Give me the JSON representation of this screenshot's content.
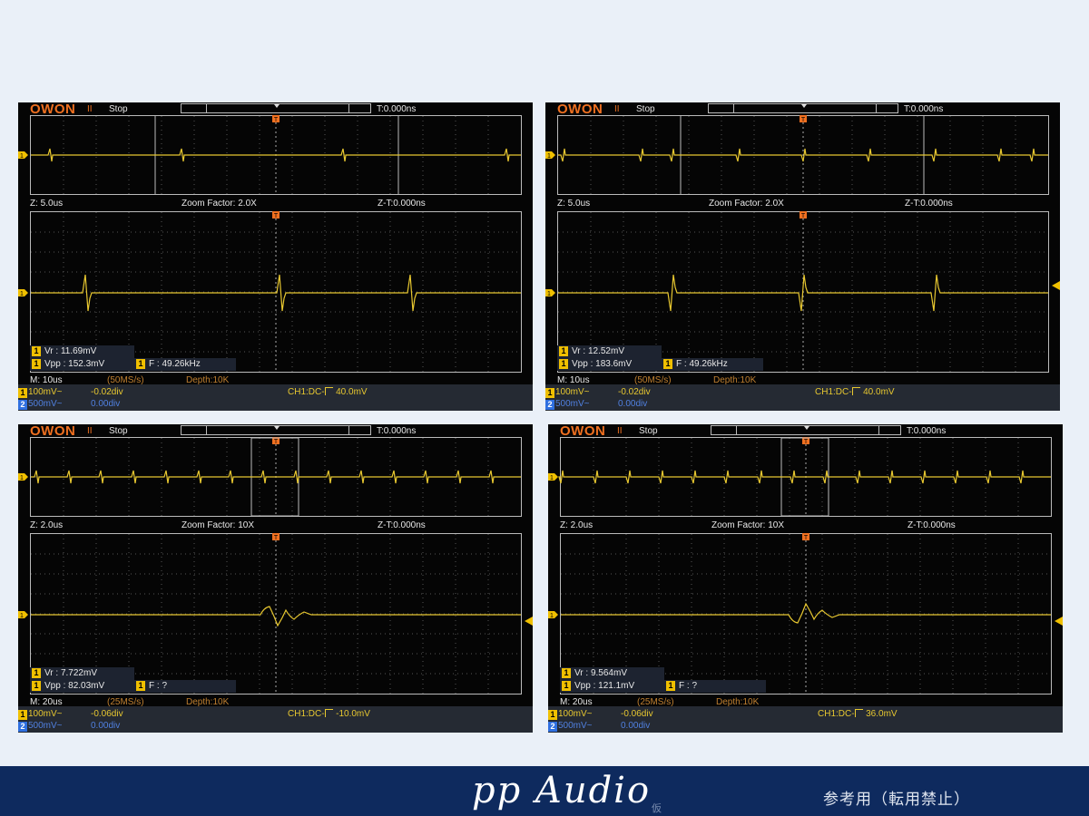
{
  "scopes": [
    {
      "logo": "OWON",
      "run_icon": "II",
      "status": "Stop",
      "trigger_time": "T:0.000ns",
      "zoom_time": "Z: 5.0us",
      "zoom_factor": "Zoom Factor: 2.0X",
      "zoom_t": "Z-T:0.000ns",
      "vr": "Vr : 11.69mV",
      "vpp": "Vpp : 152.3mV",
      "freq": "F : 49.26kHz",
      "main_time": "M: 10us",
      "sample_rate": "(50MS/s)",
      "depth": "Depth:10K",
      "ch1_scale": "100mV~",
      "ch1_offset": "-0.02div",
      "ch2_scale": "500mV~",
      "ch2_offset": "0.00div",
      "trigger": "CH1:DC-",
      "trigger_level": "40.0mV"
    },
    {
      "logo": "OWON",
      "run_icon": "II",
      "status": "Stop",
      "trigger_time": "T:0.000ns",
      "zoom_time": "Z: 5.0us",
      "zoom_factor": "Zoom Factor: 2.0X",
      "zoom_t": "Z-T:0.000ns",
      "vr": "Vr : 12.52mV",
      "vpp": "Vpp : 183.6mV",
      "freq": "F : 49.26kHz",
      "main_time": "M: 10us",
      "sample_rate": "(50MS/s)",
      "depth": "Depth:10K",
      "ch1_scale": "100mV~",
      "ch1_offset": "-0.02div",
      "ch2_scale": "500mV~",
      "ch2_offset": "0.00div",
      "trigger": "CH1:DC-",
      "trigger_level": "40.0mV"
    },
    {
      "logo": "OWON",
      "run_icon": "II",
      "status": "Stop",
      "trigger_time": "T:0.000ns",
      "zoom_time": "Z: 2.0us",
      "zoom_factor": "Zoom Factor: 10X",
      "zoom_t": "Z-T:0.000ns",
      "vr": "Vr : 7.722mV",
      "vpp": "Vpp : 82.03mV",
      "freq": "F :   ?",
      "main_time": "M: 20us",
      "sample_rate": "(25MS/s)",
      "depth": "Depth:10K",
      "ch1_scale": "100mV~",
      "ch1_offset": "-0.06div",
      "ch2_scale": "500mV~",
      "ch2_offset": "0.00div",
      "trigger": "CH1:DC-",
      "trigger_level": "-10.0mV"
    },
    {
      "logo": "OWON",
      "run_icon": "II",
      "status": "Stop",
      "trigger_time": "T:0.000ns",
      "zoom_time": "Z: 2.0us",
      "zoom_factor": "Zoom Factor: 10X",
      "zoom_t": "Z-T:0.000ns",
      "vr": "Vr : 9.564mV",
      "vpp": "Vpp : 121.1mV",
      "freq": "F :   ?",
      "main_time": "M: 20us",
      "sample_rate": "(25MS/s)",
      "depth": "Depth:10K",
      "ch1_scale": "100mV~",
      "ch1_offset": "-0.06div",
      "ch2_scale": "500mV~",
      "ch2_offset": "0.00div",
      "trigger": "CH1:DC-",
      "trigger_level": "36.0mV"
    }
  ],
  "channel_badges": {
    "ch1": "1",
    "ch2": "2"
  },
  "marker_labels": {
    "trigger": "T",
    "ch1": "1"
  },
  "footer": {
    "brand": "pp Audio",
    "brand_sub": "仮",
    "note": "参考用（転用禁止）"
  },
  "colors": {
    "trace": "#e8c830",
    "footer_bg": "#0e2a5e",
    "background": "#eaf0f8",
    "logo": "#f07020"
  }
}
